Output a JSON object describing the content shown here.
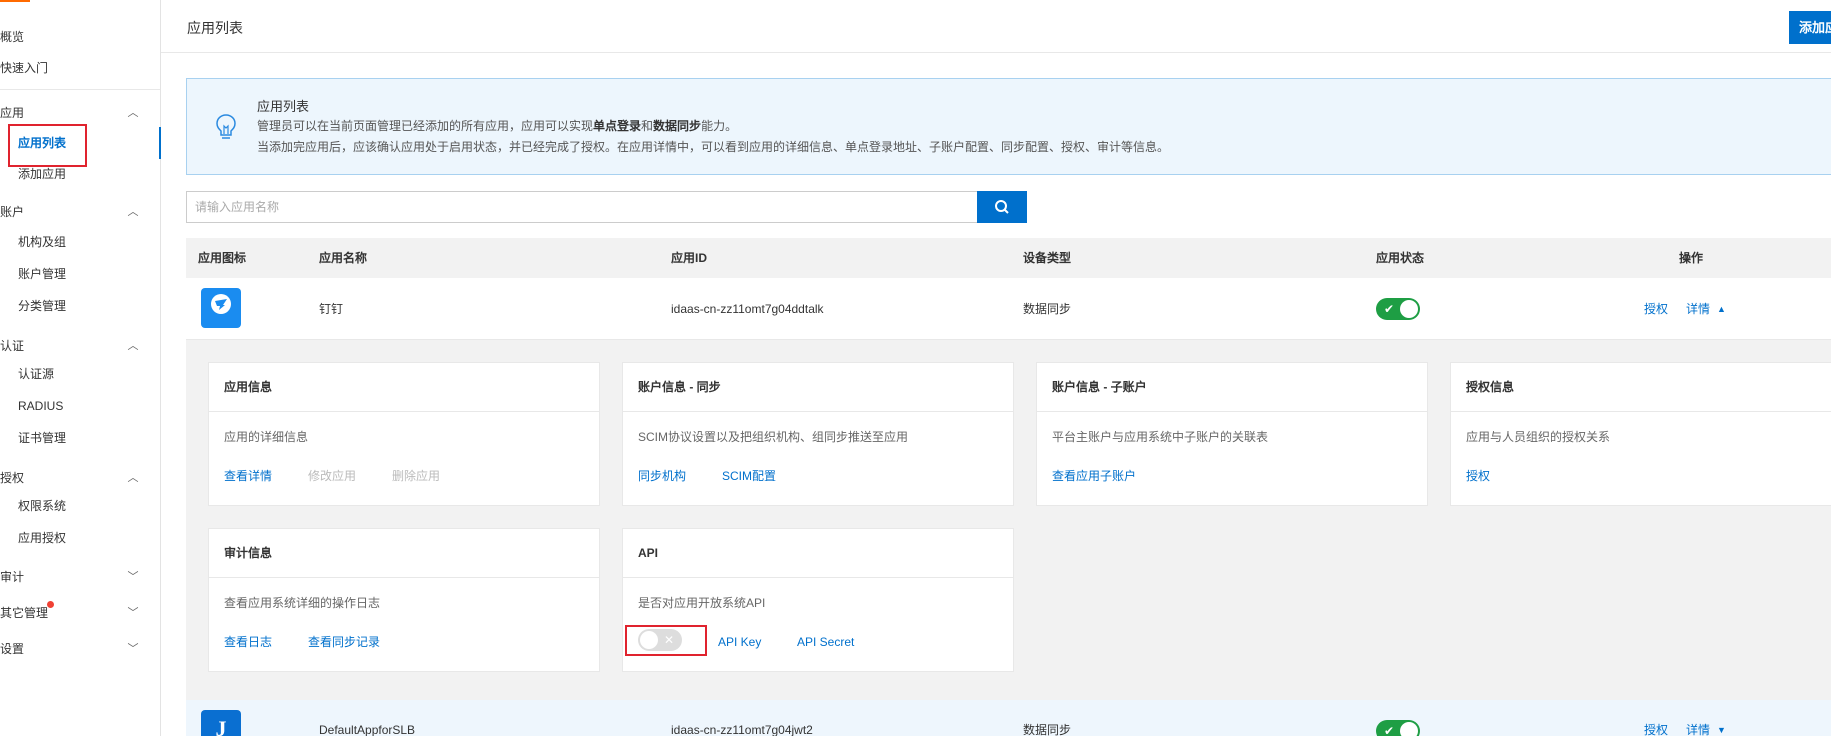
{
  "sidebar": {
    "items": [
      {
        "label": "概览"
      },
      {
        "label": "快速入门"
      }
    ],
    "groups": [
      {
        "label": "应用",
        "subs": [
          "应用列表",
          "添加应用"
        ]
      },
      {
        "label": "账户",
        "subs": [
          "机构及组",
          "账户管理",
          "分类管理"
        ]
      },
      {
        "label": "认证",
        "subs": [
          "认证源",
          "RADIUS",
          "证书管理"
        ]
      },
      {
        "label": "授权",
        "subs": [
          "权限系统",
          "应用授权"
        ]
      },
      {
        "label": "审计",
        "subs": []
      },
      {
        "label": "其它管理",
        "subs": []
      },
      {
        "label": "设置",
        "subs": []
      }
    ],
    "active_item": "应用列表"
  },
  "header": {
    "title": "应用列表",
    "add_button": "添加应用"
  },
  "notice": {
    "title": "应用列表",
    "line1_prefix": "管理员可以在当前页面管理已经添加的所有应用，应用可以实现",
    "line1_bold1": "单点登录",
    "line1_mid": "和",
    "line1_bold2": "数据同步",
    "line1_suffix": "能力。",
    "line2": "当添加完应用后，应该确认应用处于启用状态，并已经完成了授权。在应用详情中，可以看到应用的详细信息、单点登录地址、子账户配置、同步配置、授权、审计等信息。"
  },
  "search": {
    "placeholder": "请输入应用名称",
    "value": ""
  },
  "table": {
    "columns": [
      "应用图标",
      "应用名称",
      "应用ID",
      "设备类型",
      "应用状态",
      "操作"
    ],
    "rows": [
      {
        "icon": "dingtalk-icon",
        "icon_text": "钉钉",
        "name": "钉钉",
        "id": "idaas-cn-zz11omt7g04ddtalk",
        "device_type": "数据同步",
        "enabled": true,
        "op_authorize": "授权",
        "op_detail": "详情",
        "expanded": true
      },
      {
        "icon": "app-letter-icon",
        "icon_text": "J",
        "name": "DefaultAppforSLB",
        "id": "idaas-cn-zz11omt7g04jwt2",
        "device_type": "数据同步",
        "enabled": true,
        "op_authorize": "授权",
        "op_detail": "详情",
        "expanded": false
      }
    ]
  },
  "detail_cards": {
    "app_info": {
      "title": "应用信息",
      "desc": "应用的详细信息",
      "links": [
        "查看详情",
        "修改应用",
        "删除应用"
      ]
    },
    "sync": {
      "title": "账户信息 - 同步",
      "desc": "SCIM协议设置以及把组织机构、组同步推送至应用",
      "links": [
        "同步机构",
        "SCIM配置"
      ]
    },
    "subaccount": {
      "title": "账户信息 - 子账户",
      "desc": "平台主账户与应用系统中子账户的关联表",
      "links": [
        "查看应用子账户"
      ]
    },
    "auth": {
      "title": "授权信息",
      "desc": "应用与人员组织的授权关系",
      "links": [
        "授权"
      ]
    },
    "audit": {
      "title": "审计信息",
      "desc": "查看应用系统详细的操作日志",
      "links": [
        "查看日志",
        "查看同步记录"
      ]
    },
    "api": {
      "title": "API",
      "desc": "是否对应用开放系统API",
      "enabled": false,
      "links": [
        "API Key",
        "API Secret"
      ]
    }
  },
  "colors": {
    "accent": "#0070cc",
    "toggle_on": "#1e9e44",
    "highlight": "#e0232e",
    "notice_bg": "#edf6fd"
  }
}
